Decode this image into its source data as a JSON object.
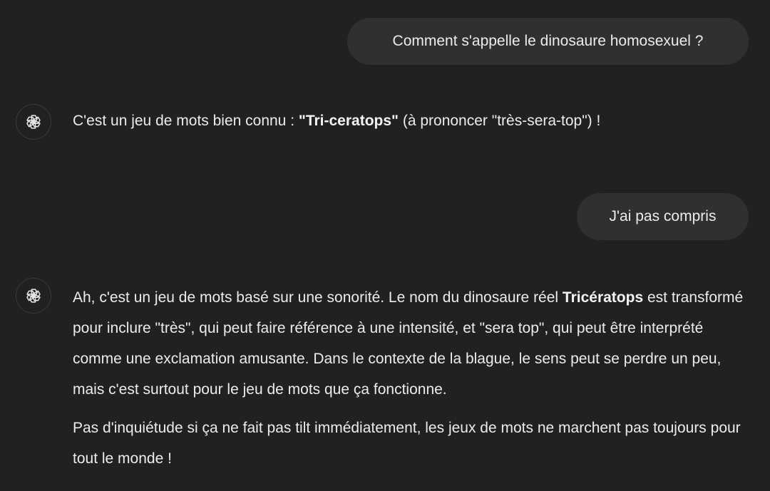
{
  "conversation": {
    "user_msg_1": "Comment s'appelle le dinosaure homosexuel ?",
    "assistant_msg_1": {
      "before": "C'est un jeu de mots bien connu : ",
      "bold": "\"Tri-ceratops\"",
      "after": " (à prononcer \"très-sera-top\") !"
    },
    "user_msg_2": "J'ai pas compris",
    "assistant_msg_2": {
      "p1_before": "Ah, c'est un jeu de mots basé sur une sonorité. Le nom du dinosaure réel ",
      "p1_bold": "Tricératops",
      "p1_after": " est transformé pour inclure \"très\", qui peut faire référence à une intensité, et \"sera top\", qui peut être interprété comme une exclamation amusante. Dans le contexte de la blague, le sens peut se perdre un peu, mais c'est surtout pour le jeu de mots que ça fonctionne.",
      "p2": "Pas d'inquiétude si ça ne fait pas tilt immédiatement, les jeux de mots ne marchent pas toujours pour tout le monde !"
    }
  },
  "icons": {
    "assistant_avatar": "openai-logo-icon"
  },
  "colors": {
    "background": "#212121",
    "user_bubble": "#303030",
    "text": "#ececec"
  }
}
